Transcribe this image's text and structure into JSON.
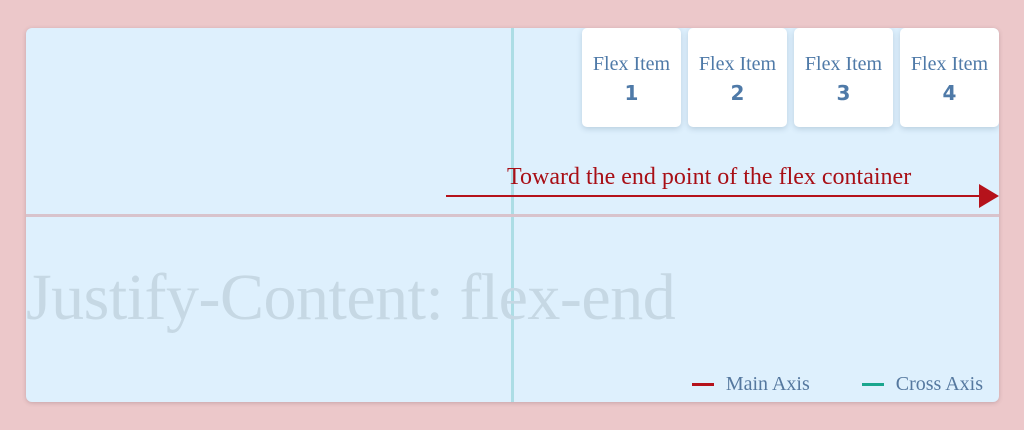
{
  "items": [
    {
      "label": "Flex Item",
      "number": "1"
    },
    {
      "label": "Flex Item",
      "number": "2"
    },
    {
      "label": "Flex Item",
      "number": "3"
    },
    {
      "label": "Flex Item",
      "number": "4"
    }
  ],
  "direction_label": "Toward the end point of the flex container",
  "watermark": "Justify-Content: flex-end",
  "legend": [
    {
      "label": "Main Axis",
      "color": "#b5121b"
    },
    {
      "label": "Cross Axis",
      "color": "#1aa68e"
    }
  ],
  "colors": {
    "background": "#ecc8ca",
    "container": "#def0fd",
    "main_axis": "#b5121b",
    "cross_axis_line": "#acdde5",
    "item_text": "#4f7aa8"
  }
}
